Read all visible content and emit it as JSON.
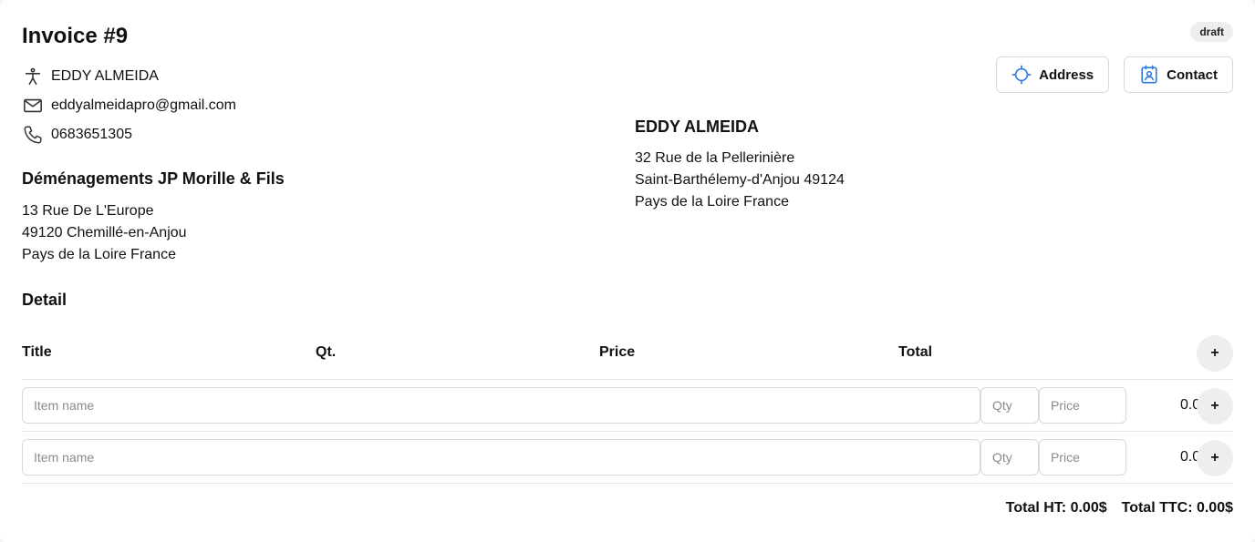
{
  "invoice": {
    "title": "Invoice #9",
    "status": "draft"
  },
  "contact": {
    "name": "EDDY ALMEIDA",
    "email": "eddyalmeidapro@gmail.com",
    "phone": "0683651305"
  },
  "company": {
    "name": "Déménagements JP Morille & Fils",
    "line1": "13 Rue De L'Europe",
    "line2": "49120 Chemillé-en-Anjou",
    "line3": "Pays de la Loire France"
  },
  "client": {
    "name": "EDDY ALMEIDA",
    "line1": "32 Rue de la Pellerinière",
    "line2": "Saint-Barthélemy-d'Anjou 49124",
    "line3": "Pays de la Loire France"
  },
  "actions": {
    "address_label": "Address",
    "contact_label": "Contact"
  },
  "detail": {
    "section_title": "Detail",
    "columns": {
      "title": "Title",
      "qty": "Qt.",
      "price": "Price",
      "total": "Total"
    },
    "add_label": "+",
    "rows": [
      {
        "item_placeholder": "Item name",
        "qty_placeholder": "Qty",
        "price_placeholder": "Price",
        "total": "0.00$",
        "add_label": "+"
      },
      {
        "item_placeholder": "Item name",
        "qty_placeholder": "Qty",
        "price_placeholder": "Price",
        "total": "0.00$",
        "add_label": "+"
      }
    ]
  },
  "totals": {
    "ht": "Total HT: 0.00$",
    "ttc": "Total TTC: 0.00$"
  },
  "icons": {
    "person": "person-icon",
    "mail": "mail-icon",
    "phone": "phone-icon",
    "crosshair": "crosshair-icon",
    "contact_card": "contact-card-icon"
  },
  "colors": {
    "accent": "#2f7de1",
    "badge_bg": "#eeeeee",
    "border": "#d9d9d9"
  }
}
